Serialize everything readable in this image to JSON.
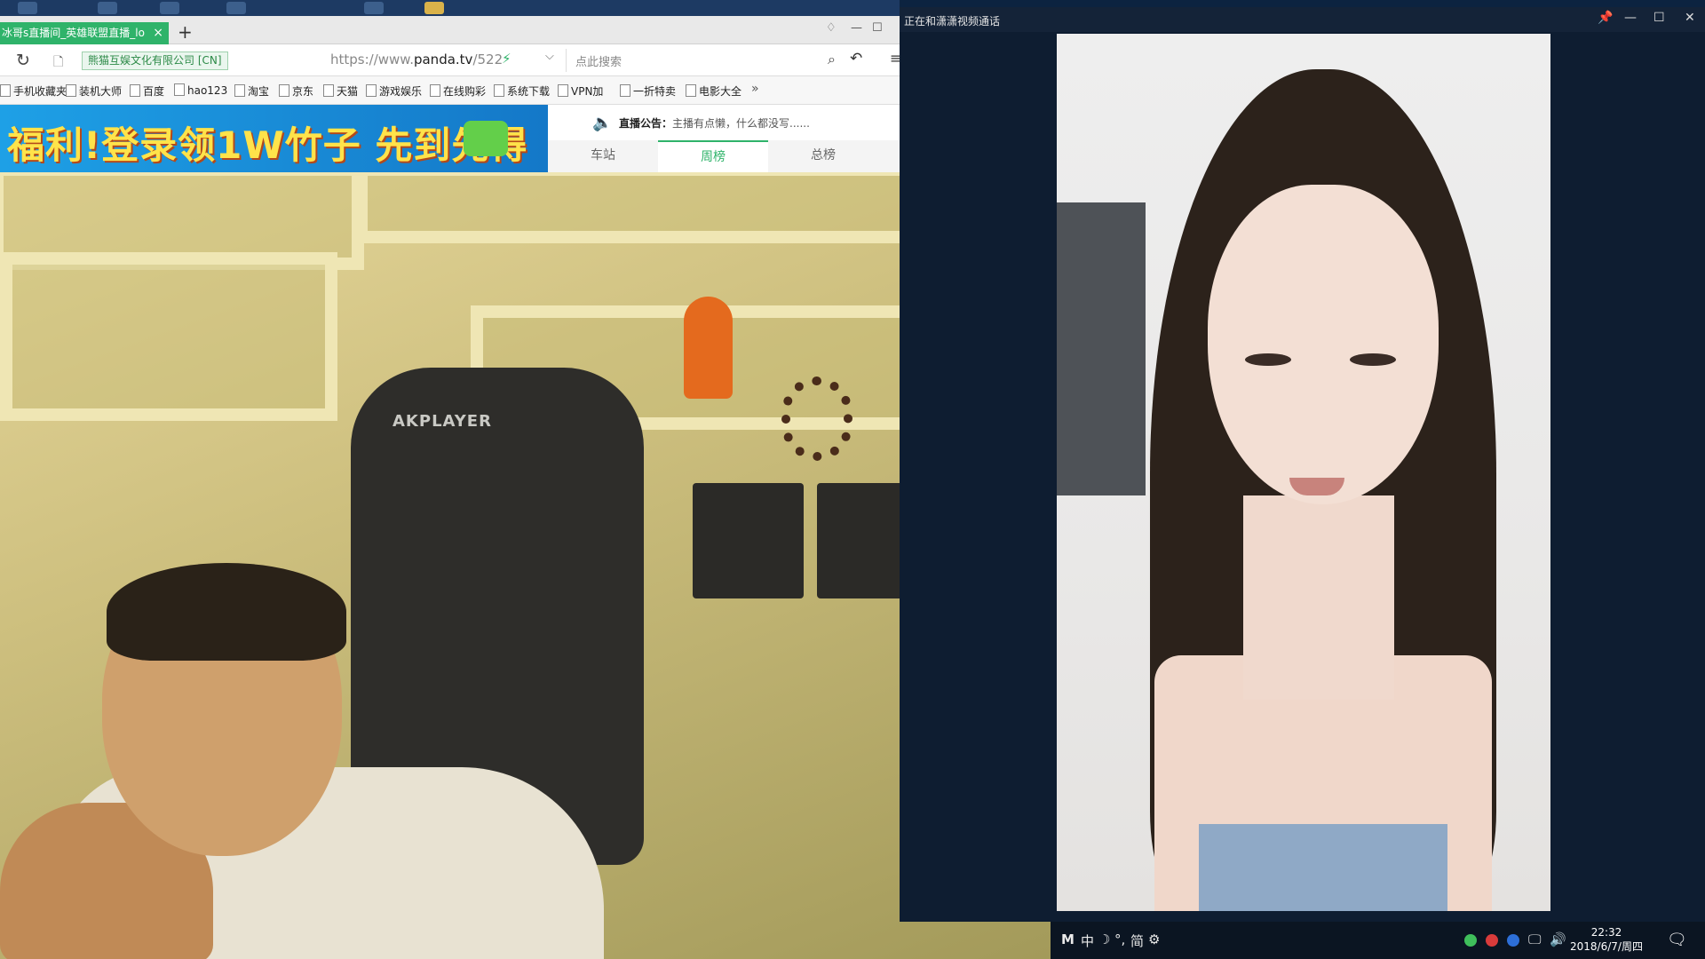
{
  "browser": {
    "tab_title": "冰哥s直播间_英雄联盟直播_lo",
    "tab_close": "×",
    "new_tab": "+",
    "cert_label": "熊猫互娱文化有限公司 [CN]",
    "url_prefix": "https://www.",
    "url_domain": "panda.tv",
    "url_path": "/522",
    "search_placeholder": "点此搜索",
    "bookmarks": [
      "手机收藏夹",
      "装机大师",
      "百度",
      "hao123",
      "淘宝",
      "京东",
      "天猫",
      "游戏娱乐",
      "在线购彩",
      "系统下载",
      "VPN加",
      "一折特卖",
      "电影大全"
    ],
    "bookmarks_more": "»"
  },
  "page": {
    "banner_text": "福利!登录领1W竹子 先到先得",
    "notice_label": "直播公告：",
    "notice_text": "主播有点懒，什么都没写......",
    "rank_tabs": [
      "车站",
      "周榜",
      "总榜"
    ],
    "rank_active": "周榜"
  },
  "webcam_left": {
    "chair_brand": "AKPLAYER"
  },
  "video_call": {
    "title": "正在和潇潇视频通话"
  },
  "taskbar": {
    "ime_m": "M",
    "ime_lang": "中",
    "ime_moon": "☽",
    "ime_punct": "°,",
    "ime_simp": "简",
    "time": "22:32",
    "date": "2018/6/7/周四"
  },
  "colors": {
    "accent_green": "#2fb36a",
    "banner_yellow": "#ffe34a",
    "banner_blue": "#1ea0e6"
  }
}
